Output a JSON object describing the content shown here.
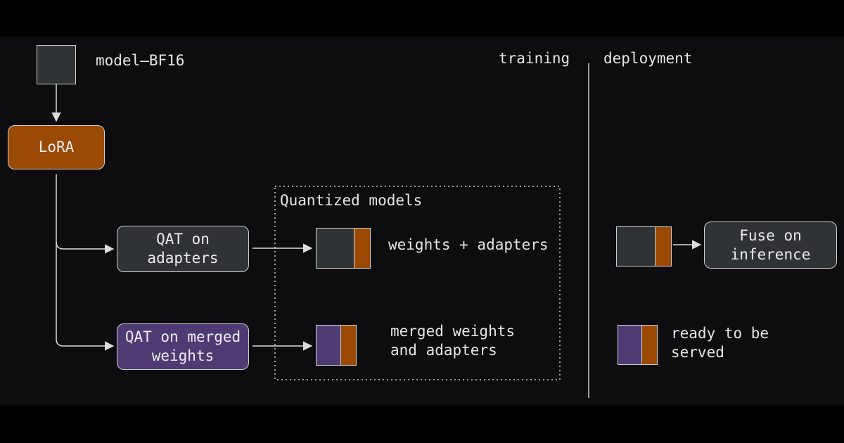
{
  "colors": {
    "base": "#2f3336",
    "adapter": "#9a4a05",
    "merged": "#4e3b73",
    "line": "#dcdcdc"
  },
  "labels": {
    "model": "model–BF16",
    "training": "training",
    "deployment": "deployment",
    "quantized": "Quantized models",
    "weights_adapters": "weights + adapters",
    "merged_adapters": "merged weights\nand adapters",
    "ready": "ready to be\nserved"
  },
  "nodes": {
    "lora": "LoRA",
    "qat_adapters": "QAT on\nadapters",
    "qat_merged": "QAT on merged\nweights",
    "fuse": "Fuse on\ninference"
  }
}
